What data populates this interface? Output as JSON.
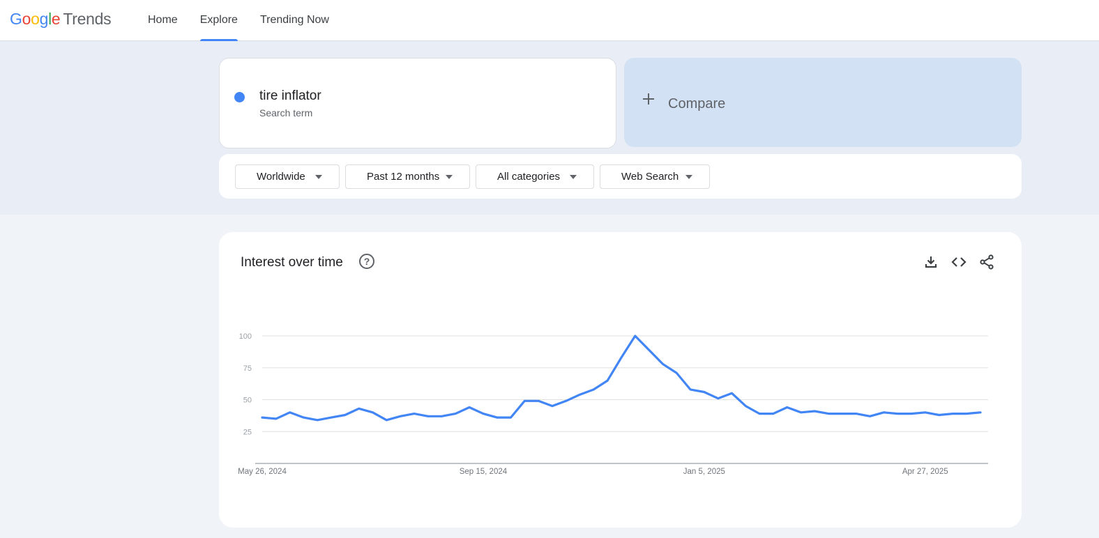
{
  "header": {
    "logo_google": [
      "G",
      "o",
      "o",
      "g",
      "l",
      "e"
    ],
    "logo_product": "Trends",
    "nav": [
      {
        "label": "Home"
      },
      {
        "label": "Explore"
      },
      {
        "label": "Trending Now"
      }
    ]
  },
  "term": {
    "name": "tire inflator",
    "type": "Search term",
    "color": "#4285f4"
  },
  "compare": {
    "label": "Compare"
  },
  "filters": [
    {
      "label": "Worldwide"
    },
    {
      "label": "Past 12 months"
    },
    {
      "label": "All categories"
    },
    {
      "label": "Web Search"
    }
  ],
  "chart_card": {
    "title": "Interest over time",
    "help_icon": "help-icon",
    "actions": [
      "download-icon",
      "embed-code-icon",
      "share-icon"
    ]
  },
  "chart_data": {
    "type": "line",
    "title": "",
    "xlabel": "",
    "ylabel": "",
    "ylim": [
      0,
      100
    ],
    "y_ticks": [
      25,
      50,
      75,
      100
    ],
    "x_tick_labels": [
      "May 26, 2024",
      "Sep 15, 2024",
      "Jan 5, 2025",
      "Apr 27, 2025"
    ],
    "x_tick_weeks": [
      0,
      16,
      32,
      48
    ],
    "grid": true,
    "legend": "none",
    "series": [
      {
        "color": "#4285f4",
        "values": [
          36,
          35,
          40,
          36,
          34,
          36,
          38,
          43,
          40,
          34,
          37,
          39,
          37,
          37,
          39,
          44,
          39,
          36,
          36,
          49,
          49,
          45,
          49,
          54,
          58,
          65,
          83,
          100,
          89,
          78,
          71,
          58,
          56,
          51,
          55,
          45,
          39,
          39,
          44,
          40,
          41,
          39,
          39,
          39,
          37,
          40,
          39,
          39,
          40,
          38,
          39,
          39,
          40
        ]
      }
    ]
  }
}
